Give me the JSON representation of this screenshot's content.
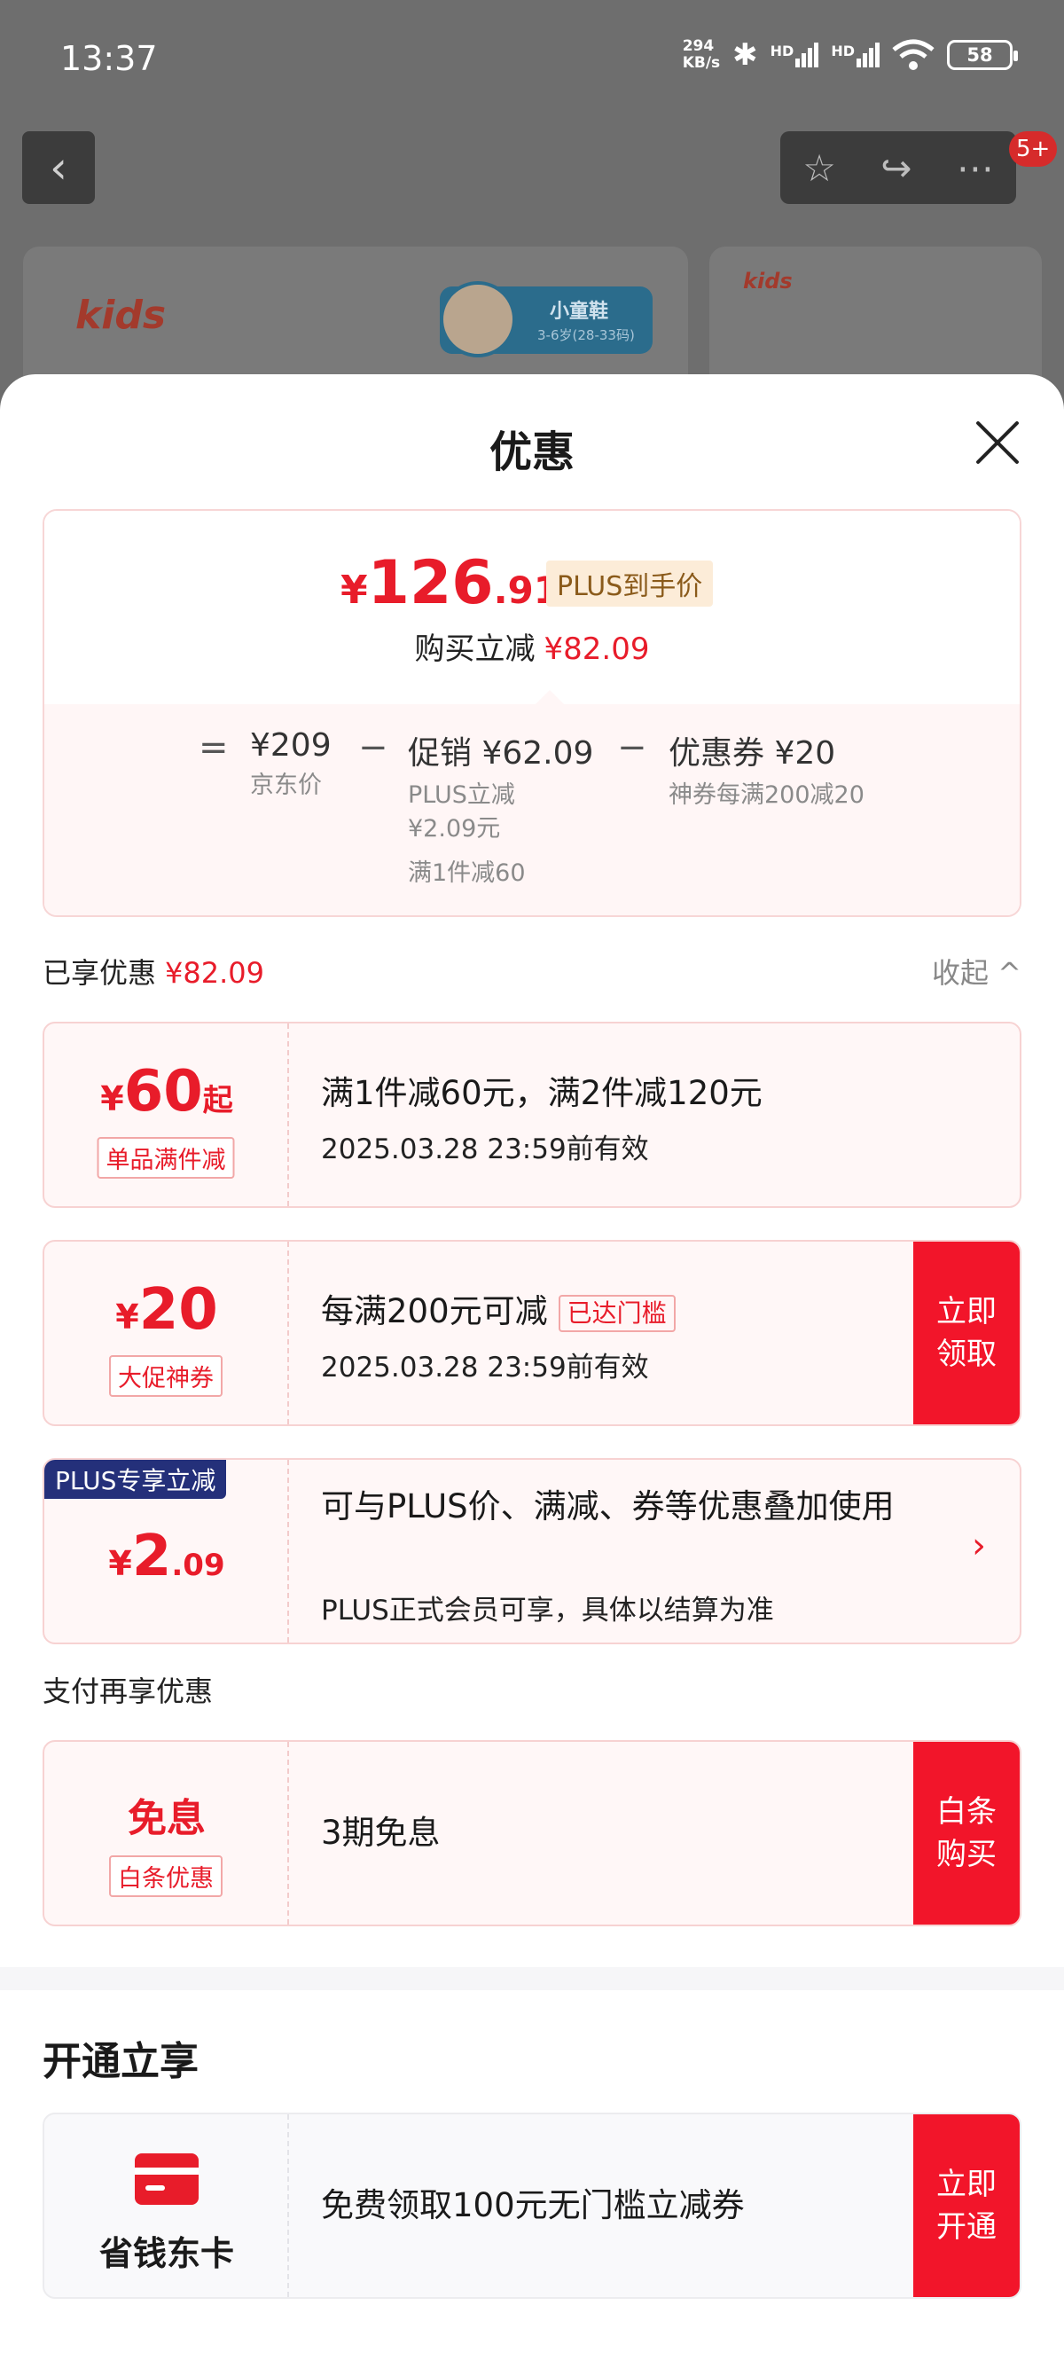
{
  "status_bar": {
    "time": "13:37",
    "net_speed_value": "294",
    "net_speed_unit": "KB/s",
    "signal1_label": "HD",
    "signal2_label": "HD",
    "battery": "58",
    "icons": [
      "bluetooth-icon",
      "signal-icon",
      "wifi-icon",
      "battery-icon"
    ]
  },
  "background": {
    "badge": "5+",
    "brand_logo": "kids",
    "size_tag_name": "小童鞋",
    "size_tag_range": "3-6岁(28-33码)",
    "icons": [
      "back-arrow-icon",
      "star-icon",
      "share-icon",
      "more-icon"
    ]
  },
  "sheet": {
    "title": "优惠",
    "summary": {
      "price_symbol": "¥",
      "price_int": "126",
      "price_dec": ".91",
      "plus_tag": "PLUS到手价",
      "reduce_label": "购买立减",
      "reduce_value": "¥82.09",
      "eq": "=",
      "minus": "−",
      "jd_price": "¥209",
      "jd_price_label": "京东价",
      "promo": "促销 ¥62.09",
      "promo_sub1": "PLUS立减",
      "promo_sub2": "¥2.09元",
      "promo_sub3": "满1件减60",
      "coupon": "优惠券 ¥20",
      "coupon_sub": "神券每满200减20"
    },
    "enjoyed": {
      "label": "已享优惠",
      "value": "¥82.09",
      "collapse": "收起 ^"
    },
    "coupons": [
      {
        "symbol": "¥",
        "amount": "60",
        "suffix": "起",
        "tag": "单品满件减",
        "main": "满1件减60元，满2件减120元",
        "sub": "2025.03.28 23:59前有效"
      },
      {
        "symbol": "¥",
        "amount": "20",
        "tag": "大促神券",
        "main": "每满200元可减",
        "reached": "已达门槛",
        "sub": "2025.03.28 23:59前有效",
        "button": "立即领取"
      },
      {
        "corner": "PLUS专享立减",
        "symbol": "¥",
        "amount": "2",
        "dec": ".09",
        "main": "可与PLUS价、满减、券等优惠叠加使用",
        "sub": "PLUS正式会员可享，具体以结算为准"
      }
    ],
    "pay_section": {
      "title": "支付再享优惠",
      "amount": "免息",
      "tag": "白条优惠",
      "main": "3期免息",
      "button": "白条购买"
    },
    "open_section": {
      "title": "开通立享",
      "card_name": "省钱东卡",
      "main": "免费领取100元无门槛立减券",
      "button": "立即开通"
    }
  }
}
